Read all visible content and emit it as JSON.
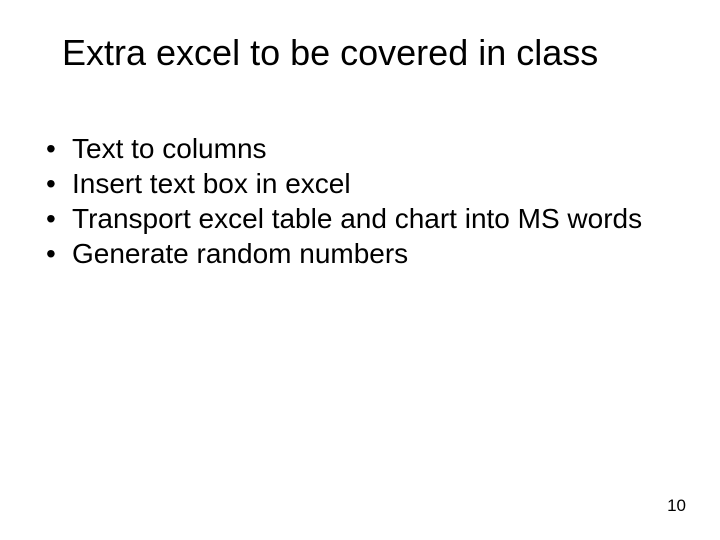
{
  "slide": {
    "title": "Extra excel to be covered in class",
    "bullets": [
      "Text to columns",
      "Insert text box in excel",
      "Transport excel table and chart into MS words",
      "Generate random numbers"
    ],
    "page_number": "10"
  }
}
